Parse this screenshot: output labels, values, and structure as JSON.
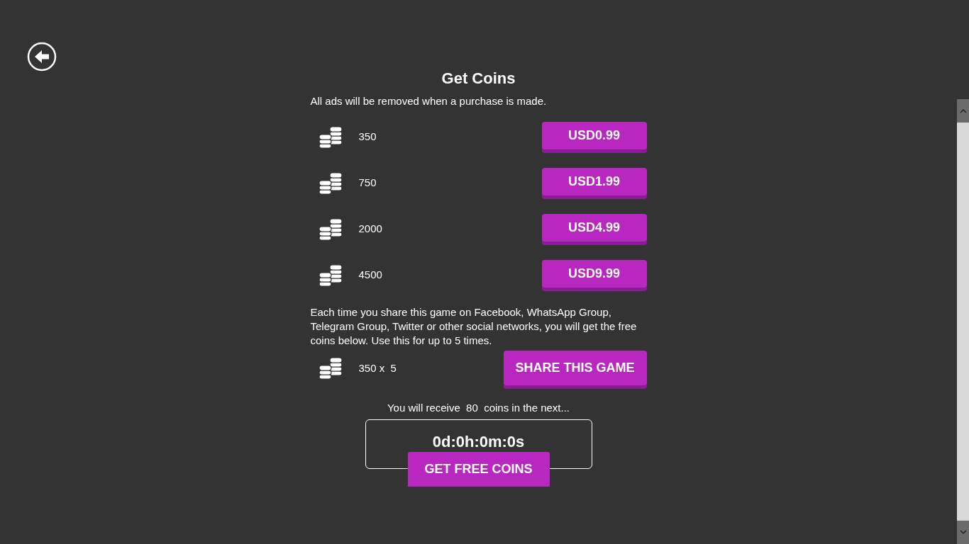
{
  "title": "Get Coins",
  "subtitle": "All ads will be removed when a purchase is made.",
  "packs": [
    {
      "amount": "350",
      "price": "USD0.99"
    },
    {
      "amount": "750",
      "price": "USD1.99"
    },
    {
      "amount": "2000",
      "price": "USD4.99"
    },
    {
      "amount": "4500",
      "price": "USD9.99"
    }
  ],
  "share": {
    "text": "Each time you share this game on Facebook, WhatsApp Group, Telegram Group, Twitter or other social networks, you will get the free coins below. Use this for up to 5 times.",
    "amount": "350 x  5",
    "button": "SHARE THIS GAME"
  },
  "free": {
    "text": "You will receive  80  coins in the next...",
    "timer": "0d:0h:0m:0s",
    "button": "GET FREE COINS"
  }
}
